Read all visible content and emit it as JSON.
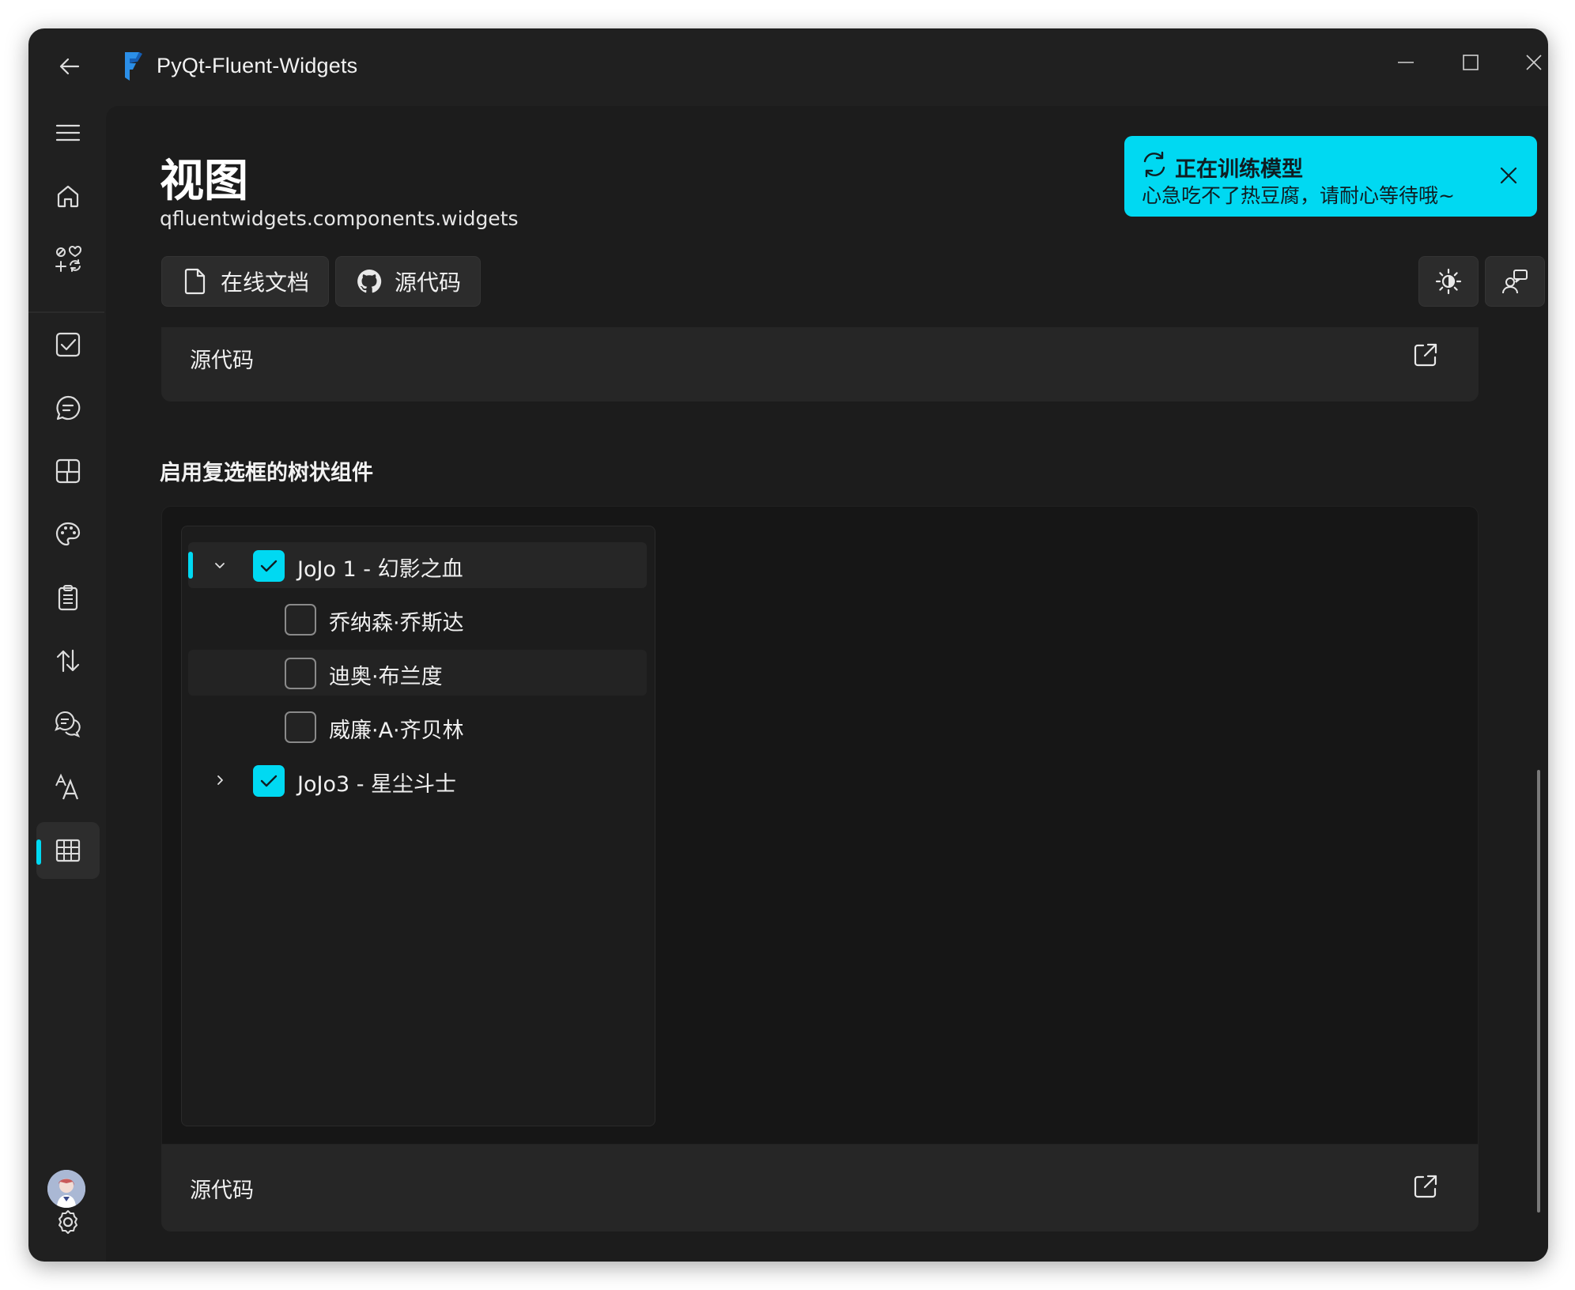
{
  "window": {
    "title": "PyQt-Fluent-Widgets"
  },
  "nav": {
    "items": [
      {
        "name": "menu",
        "icon": "hamburger-menu-icon"
      },
      {
        "name": "home",
        "icon": "home-icon"
      },
      {
        "name": "icons",
        "icon": "emoji-tab-symbols-icon"
      },
      {
        "name": "basic-input",
        "icon": "checkbox-icon"
      },
      {
        "name": "dialog",
        "icon": "chat-bubble-icon"
      },
      {
        "name": "layout",
        "icon": "layout-icon"
      },
      {
        "name": "material",
        "icon": "palette-icon"
      },
      {
        "name": "menu-page",
        "icon": "clipboard-list-icon"
      },
      {
        "name": "navigation",
        "icon": "arrow-up-down-icon"
      },
      {
        "name": "status-info",
        "icon": "chat-multiple-icon"
      },
      {
        "name": "text",
        "icon": "text-font-icon"
      },
      {
        "name": "view",
        "icon": "grid-table-icon",
        "selected": true
      }
    ],
    "accent": "#00d9f2"
  },
  "header": {
    "title": "视图",
    "subtitle": "qfluentwidgets.components.widgets",
    "doc_button": "在线文档",
    "source_button": "源代码"
  },
  "top_card": {
    "label": "源代码"
  },
  "section": {
    "title": "启用复选框的树状组件"
  },
  "tree": {
    "rows": [
      {
        "label": "JoJo 1 - 幻影之血",
        "checked": true,
        "expanded": true,
        "level": 0
      },
      {
        "label": "乔纳森·乔斯达",
        "checked": false,
        "level": 1
      },
      {
        "label": "迪奥·布兰度",
        "checked": false,
        "level": 1
      },
      {
        "label": "威廉·A·齐贝林",
        "checked": false,
        "level": 1
      },
      {
        "label": "JoJo3 - 星尘斗士",
        "checked": true,
        "expanded": false,
        "level": 0
      }
    ]
  },
  "bottom_card": {
    "label": "源代码"
  },
  "toast": {
    "title": "正在训练模型",
    "content": "心急吃不了热豆腐，请耐心等待哦~",
    "color": "#00d9f2"
  }
}
